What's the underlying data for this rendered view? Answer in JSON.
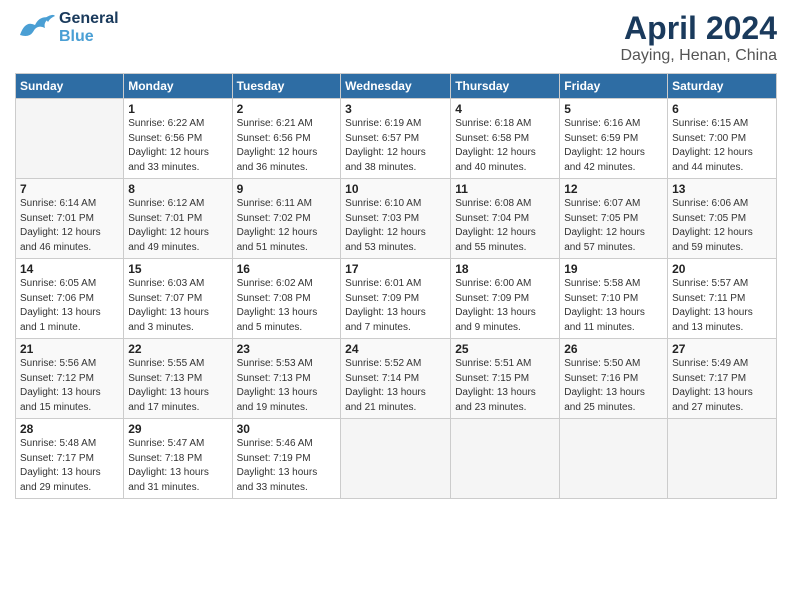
{
  "header": {
    "logo_general": "General",
    "logo_blue": "Blue",
    "month_title": "April 2024",
    "subtitle": "Daying, Henan, China"
  },
  "weekdays": [
    "Sunday",
    "Monday",
    "Tuesday",
    "Wednesday",
    "Thursday",
    "Friday",
    "Saturday"
  ],
  "weeks": [
    [
      {
        "day": "",
        "info": ""
      },
      {
        "day": "1",
        "info": "Sunrise: 6:22 AM\nSunset: 6:56 PM\nDaylight: 12 hours\nand 33 minutes."
      },
      {
        "day": "2",
        "info": "Sunrise: 6:21 AM\nSunset: 6:56 PM\nDaylight: 12 hours\nand 36 minutes."
      },
      {
        "day": "3",
        "info": "Sunrise: 6:19 AM\nSunset: 6:57 PM\nDaylight: 12 hours\nand 38 minutes."
      },
      {
        "day": "4",
        "info": "Sunrise: 6:18 AM\nSunset: 6:58 PM\nDaylight: 12 hours\nand 40 minutes."
      },
      {
        "day": "5",
        "info": "Sunrise: 6:16 AM\nSunset: 6:59 PM\nDaylight: 12 hours\nand 42 minutes."
      },
      {
        "day": "6",
        "info": "Sunrise: 6:15 AM\nSunset: 7:00 PM\nDaylight: 12 hours\nand 44 minutes."
      }
    ],
    [
      {
        "day": "7",
        "info": "Sunrise: 6:14 AM\nSunset: 7:01 PM\nDaylight: 12 hours\nand 46 minutes."
      },
      {
        "day": "8",
        "info": "Sunrise: 6:12 AM\nSunset: 7:01 PM\nDaylight: 12 hours\nand 49 minutes."
      },
      {
        "day": "9",
        "info": "Sunrise: 6:11 AM\nSunset: 7:02 PM\nDaylight: 12 hours\nand 51 minutes."
      },
      {
        "day": "10",
        "info": "Sunrise: 6:10 AM\nSunset: 7:03 PM\nDaylight: 12 hours\nand 53 minutes."
      },
      {
        "day": "11",
        "info": "Sunrise: 6:08 AM\nSunset: 7:04 PM\nDaylight: 12 hours\nand 55 minutes."
      },
      {
        "day": "12",
        "info": "Sunrise: 6:07 AM\nSunset: 7:05 PM\nDaylight: 12 hours\nand 57 minutes."
      },
      {
        "day": "13",
        "info": "Sunrise: 6:06 AM\nSunset: 7:05 PM\nDaylight: 12 hours\nand 59 minutes."
      }
    ],
    [
      {
        "day": "14",
        "info": "Sunrise: 6:05 AM\nSunset: 7:06 PM\nDaylight: 13 hours\nand 1 minute."
      },
      {
        "day": "15",
        "info": "Sunrise: 6:03 AM\nSunset: 7:07 PM\nDaylight: 13 hours\nand 3 minutes."
      },
      {
        "day": "16",
        "info": "Sunrise: 6:02 AM\nSunset: 7:08 PM\nDaylight: 13 hours\nand 5 minutes."
      },
      {
        "day": "17",
        "info": "Sunrise: 6:01 AM\nSunset: 7:09 PM\nDaylight: 13 hours\nand 7 minutes."
      },
      {
        "day": "18",
        "info": "Sunrise: 6:00 AM\nSunset: 7:09 PM\nDaylight: 13 hours\nand 9 minutes."
      },
      {
        "day": "19",
        "info": "Sunrise: 5:58 AM\nSunset: 7:10 PM\nDaylight: 13 hours\nand 11 minutes."
      },
      {
        "day": "20",
        "info": "Sunrise: 5:57 AM\nSunset: 7:11 PM\nDaylight: 13 hours\nand 13 minutes."
      }
    ],
    [
      {
        "day": "21",
        "info": "Sunrise: 5:56 AM\nSunset: 7:12 PM\nDaylight: 13 hours\nand 15 minutes."
      },
      {
        "day": "22",
        "info": "Sunrise: 5:55 AM\nSunset: 7:13 PM\nDaylight: 13 hours\nand 17 minutes."
      },
      {
        "day": "23",
        "info": "Sunrise: 5:53 AM\nSunset: 7:13 PM\nDaylight: 13 hours\nand 19 minutes."
      },
      {
        "day": "24",
        "info": "Sunrise: 5:52 AM\nSunset: 7:14 PM\nDaylight: 13 hours\nand 21 minutes."
      },
      {
        "day": "25",
        "info": "Sunrise: 5:51 AM\nSunset: 7:15 PM\nDaylight: 13 hours\nand 23 minutes."
      },
      {
        "day": "26",
        "info": "Sunrise: 5:50 AM\nSunset: 7:16 PM\nDaylight: 13 hours\nand 25 minutes."
      },
      {
        "day": "27",
        "info": "Sunrise: 5:49 AM\nSunset: 7:17 PM\nDaylight: 13 hours\nand 27 minutes."
      }
    ],
    [
      {
        "day": "28",
        "info": "Sunrise: 5:48 AM\nSunset: 7:17 PM\nDaylight: 13 hours\nand 29 minutes."
      },
      {
        "day": "29",
        "info": "Sunrise: 5:47 AM\nSunset: 7:18 PM\nDaylight: 13 hours\nand 31 minutes."
      },
      {
        "day": "30",
        "info": "Sunrise: 5:46 AM\nSunset: 7:19 PM\nDaylight: 13 hours\nand 33 minutes."
      },
      {
        "day": "",
        "info": ""
      },
      {
        "day": "",
        "info": ""
      },
      {
        "day": "",
        "info": ""
      },
      {
        "day": "",
        "info": ""
      }
    ]
  ]
}
